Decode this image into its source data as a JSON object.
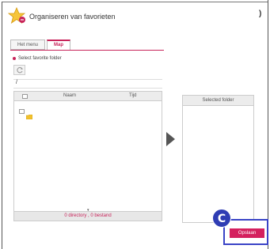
{
  "header": {
    "title": "Organiseren van favorieten",
    "close_label": ")"
  },
  "tabs": [
    {
      "label": "Het menu",
      "active": false
    },
    {
      "label": "Map",
      "active": true
    }
  ],
  "section": {
    "select_label": "Select favorite folder"
  },
  "path": {
    "current": "/"
  },
  "table": {
    "columns": [
      "Naam",
      "Tijd"
    ],
    "footer_count": "0 directory , 0 bestand",
    "scroll_indicator": "▾"
  },
  "selected": {
    "header": "Selected folder"
  },
  "actions": {
    "save_label": "Opslaan",
    "badge": "C"
  },
  "colors": {
    "accent": "#c8235a",
    "highlight": "#3a44c6"
  }
}
